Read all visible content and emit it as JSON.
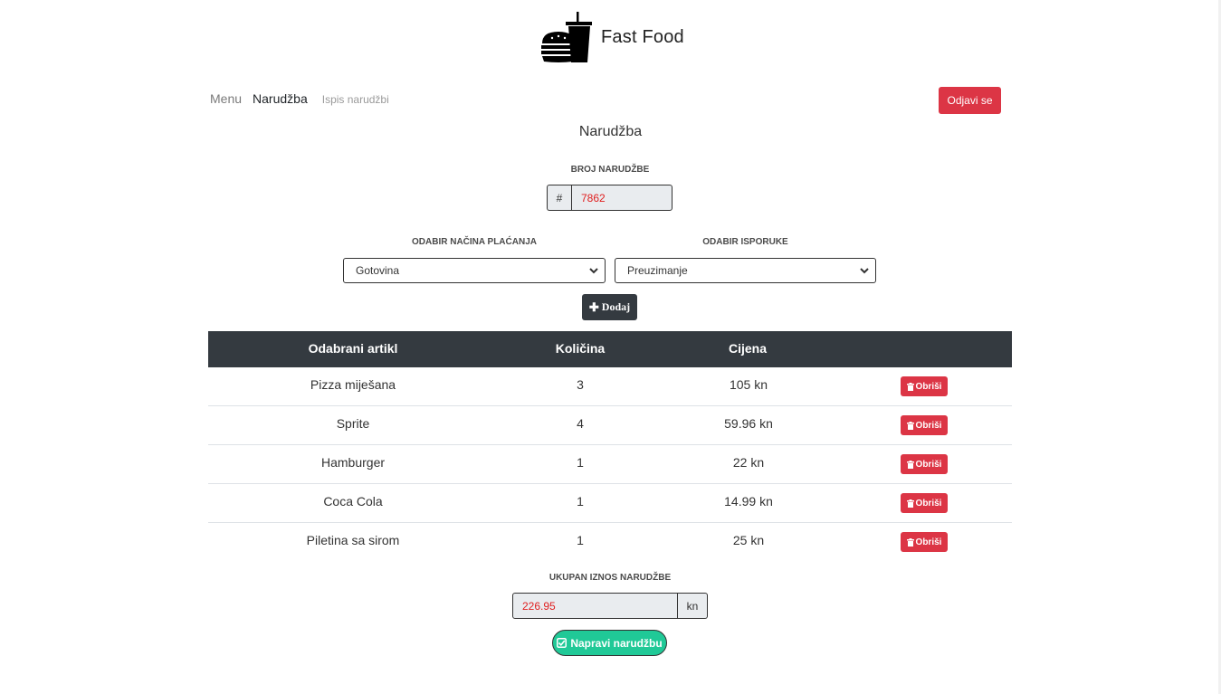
{
  "brand": {
    "title": "Fast Food",
    "logo_icon": "burger-drink-icon"
  },
  "nav": {
    "items": [
      "Menu",
      "Narudžba",
      "Ispis narudžbi"
    ],
    "logout_label": "Odjavi se"
  },
  "page": {
    "title": "Narudžba"
  },
  "order_number": {
    "label": "BROJ NARUDŽBE",
    "prefix": "#",
    "value": "7862"
  },
  "payment": {
    "label": "ODABIR NAČINA PLAĆANJA",
    "selected": "Gotovina"
  },
  "delivery": {
    "label": "ODABIR ISPORUKE",
    "selected": "Preuzimanje"
  },
  "add_button": {
    "label": "Dodaj",
    "icon": "plus-icon"
  },
  "table": {
    "headers": [
      "Odabrani artikl",
      "Količina",
      "Cijena",
      ""
    ],
    "rows": [
      {
        "item": "Pizza miješana",
        "qty": "3",
        "price": "105 kn"
      },
      {
        "item": "Sprite",
        "qty": "4",
        "price": "59.96 kn"
      },
      {
        "item": "Hamburger",
        "qty": "1",
        "price": "22 kn"
      },
      {
        "item": "Coca Cola",
        "qty": "1",
        "price": "14.99 kn"
      },
      {
        "item": "Piletina sa sirom",
        "qty": "1",
        "price": "25 kn"
      }
    ],
    "delete_label": "Obriši",
    "delete_icon": "trash-icon"
  },
  "total": {
    "label": "UKUPAN IZNOS NARUDŽBE",
    "value": "226.95",
    "unit": "kn"
  },
  "submit": {
    "label": "Napravi narudžbu",
    "icon": "check-square-icon"
  },
  "colors": {
    "danger": "#dc3545",
    "dark": "#343a40",
    "success": "#20c997",
    "readonly_bg": "#e9ecef",
    "value_text": "#e02020"
  }
}
